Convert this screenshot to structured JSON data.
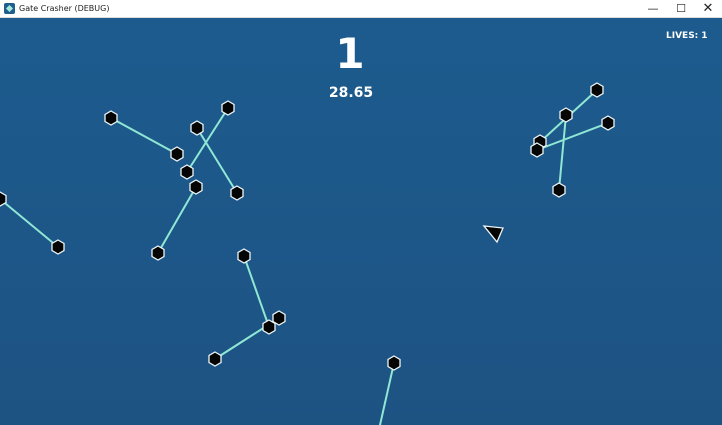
{
  "window": {
    "title": "Gate Crasher (DEBUG)",
    "controls": {
      "minimize": "—",
      "maximize": "☐",
      "close": "✕"
    }
  },
  "hud": {
    "score": "1",
    "timer": "28.65",
    "lives_label": "LIVES:",
    "lives_value": "1"
  },
  "colors": {
    "background": "#1d5a8d",
    "gate_line": "#8fe7d4",
    "node_fill": "#050505",
    "node_outline": "#eef6f8"
  }
}
